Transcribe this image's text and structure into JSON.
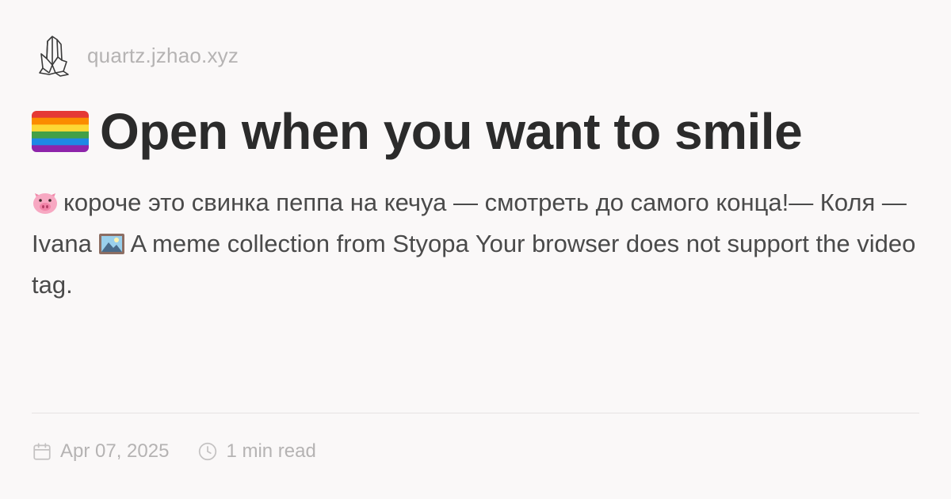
{
  "header": {
    "logo_icon": "crystal-icon",
    "site_name": "quartz.jzhao.xyz"
  },
  "title": {
    "flag_icon": "rainbow-flag-icon",
    "text": "Open when you want to smile"
  },
  "description": {
    "pig_icon": "pig-face-icon",
    "text_part1": "короче это свинка пеппа на кечуа — смотреть до самого конца!— Коля — Ivana",
    "picture_icon": "framed-picture-icon",
    "text_part2": "A meme collection from Styopa Your browser does not support the video tag."
  },
  "meta": {
    "date_icon": "calendar-icon",
    "date": "Apr 07, 2025",
    "time_icon": "clock-icon",
    "read_time": "1 min read"
  },
  "colors": {
    "background": "#faf8f8",
    "title": "#2b2b2b",
    "muted": "#b5b3b3",
    "body_text": "#4a4a4a"
  }
}
